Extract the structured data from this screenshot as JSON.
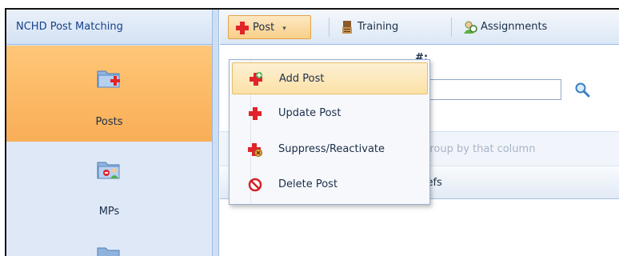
{
  "nav": {
    "title": "NCHD Post Matching",
    "items": [
      {
        "label": "Posts",
        "icon": "folder-add-icon",
        "active": true
      },
      {
        "label": "MPs",
        "icon": "folder-user-icon",
        "active": false
      },
      {
        "label": "",
        "icon": "folder-icon",
        "active": false
      }
    ]
  },
  "toolbar": {
    "post_label": "Post",
    "post_caret": "▾",
    "training_label": "Training",
    "assignments_label": "Assignments"
  },
  "search": {
    "post_number_label": "#:",
    "value": ""
  },
  "grid": {
    "group_hint": "o group by that column",
    "refs_header": "Refs"
  },
  "menu": {
    "items": [
      {
        "label": "Add Post",
        "icon": "add-post-icon",
        "highlighted": true
      },
      {
        "label": "Update Post",
        "icon": "update-post-icon",
        "highlighted": false
      },
      {
        "label": "Suppress/Reactivate",
        "icon": "suppress-reactivate-icon",
        "highlighted": false
      },
      {
        "label": "Delete Post",
        "icon": "delete-post-icon",
        "highlighted": false
      }
    ]
  },
  "colors": {
    "accent_orange": "#f9ad56",
    "nav_bg": "#dfe8f6",
    "red_cross": "#e0242a"
  }
}
